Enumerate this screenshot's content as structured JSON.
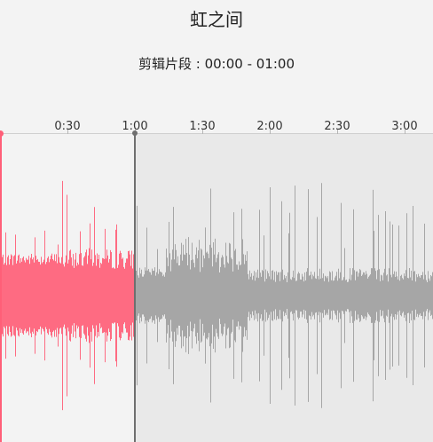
{
  "title": "虹之间",
  "clip_range_label": "剪辑片段 : 00:00 - 01:00",
  "timeline": {
    "ticks": [
      "0:30",
      "1:00",
      "1:30",
      "2:00",
      "2:30",
      "3:00"
    ]
  },
  "colors": {
    "accent": "#ff5f78",
    "waveform_unselected": "#9a9a9a",
    "playhead": "#6f6f6f"
  },
  "icons": [
    "start-handle-icon",
    "playhead-handle-icon"
  ]
}
